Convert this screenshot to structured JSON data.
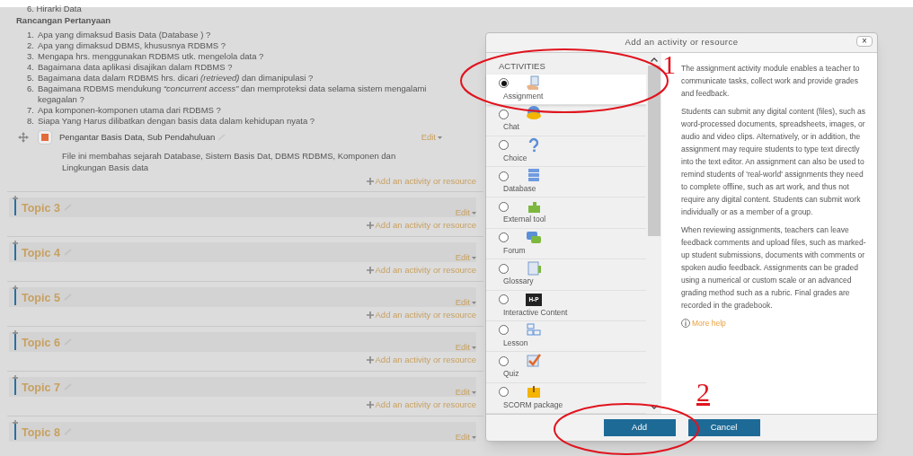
{
  "course": {
    "top_item": "6. Hirarki Data",
    "heading": "Rancangan  Pertanyaan",
    "questions": [
      {
        "number": "1.",
        "text": "Apa yang dimaksud Basis Data (Database ) ?"
      },
      {
        "number": "2.",
        "text": "Apa yang dimaksud DBMS, khususnya RDBMS ?"
      },
      {
        "number": "3.",
        "text": "Mengapa hrs. menggunakan RDBMS utk. mengelola data ?"
      },
      {
        "number": "4.",
        "text": "Bagaimana data aplikasi disajikan dalam RDBMS ?"
      },
      {
        "number": "5.",
        "text": "Bagaimana data dalam RDBMS hrs. dicari *(retrieved)* dan dimanipulasi ?"
      },
      {
        "number": "6.",
        "text": "Bagaimana RDBMS mendukung *“concurrent access”* dan memproteksi data selama sistem mengalami kegagalan ?"
      },
      {
        "number": "7.",
        "text": "Apa komponen-komponen utama dari RDBMS ?"
      },
      {
        "number": "8.",
        "text": "Siapa Yang Harus dilibatkan dengan basis data dalam kehidupan nyata ?"
      }
    ],
    "resource": {
      "title": "Pengantar Basis Data, Sub Pendahuluan",
      "edit": "Edit",
      "description": "File ini membahas sejarah Database, Sistem Basis Dat, DBMS RDBMS, Komponen dan Lingkungan Basis data"
    },
    "add_link": "Add an activity or resource",
    "topics": [
      {
        "title": "Topic 3",
        "edit": "Edit",
        "add_link": "Add an activity or resource"
      },
      {
        "title": "Topic 4",
        "edit": "Edit",
        "add_link": "Add an activity or resource"
      },
      {
        "title": "Topic 5",
        "edit": "Edit",
        "add_link": "Add an activity or resource"
      },
      {
        "title": "Topic 6",
        "edit": "Edit",
        "add_link": "Add an activity or resource"
      },
      {
        "title": "Topic 7",
        "edit": "Edit",
        "add_link": "Add an activity or resource"
      },
      {
        "title": "Topic 8",
        "edit": "Edit"
      }
    ]
  },
  "dialog": {
    "title": "Add an activity or resource",
    "close": "×",
    "section": "ACTIVITIES",
    "activities": [
      {
        "label": "Assignment",
        "selected": true
      },
      {
        "label": "Chat",
        "selected": false
      },
      {
        "label": "Choice",
        "selected": false
      },
      {
        "label": "Database",
        "selected": false
      },
      {
        "label": "External tool",
        "selected": false
      },
      {
        "label": "Forum",
        "selected": false
      },
      {
        "label": "Glossary",
        "selected": false
      },
      {
        "label": "Interactive Content",
        "selected": false,
        "icon_text": "H-P"
      },
      {
        "label": "Lesson",
        "selected": false
      },
      {
        "label": "Quiz",
        "selected": false
      },
      {
        "label": "SCORM package",
        "selected": false
      }
    ],
    "description": [
      "The assignment activity module enables a teacher to communicate tasks, collect work and provide grades and feedback.",
      "Students can submit any digital content (files), such as word-processed documents, spreadsheets, images, or audio and video clips. Alternatively, or in addition, the assignment may require students to type text directly into the text editor. An assignment can also be used to remind students of 'real-world' assignments they need to complete offline, such as art work, and thus not require any digital content. Students can submit work individually or as a member of a group.",
      "When reviewing assignments, teachers can leave feedback comments and upload files, such as marked-up student submissions, documents with comments or spoken audio feedback. Assignments can be graded using a numerical or custom scale or an advanced grading method such as a rubric. Final grades are recorded in the gradebook."
    ],
    "more_help": "More help",
    "buttons": [
      "Add",
      "Cancel"
    ]
  },
  "annotations": [
    {
      "label": "1"
    },
    {
      "label": "2"
    }
  ]
}
